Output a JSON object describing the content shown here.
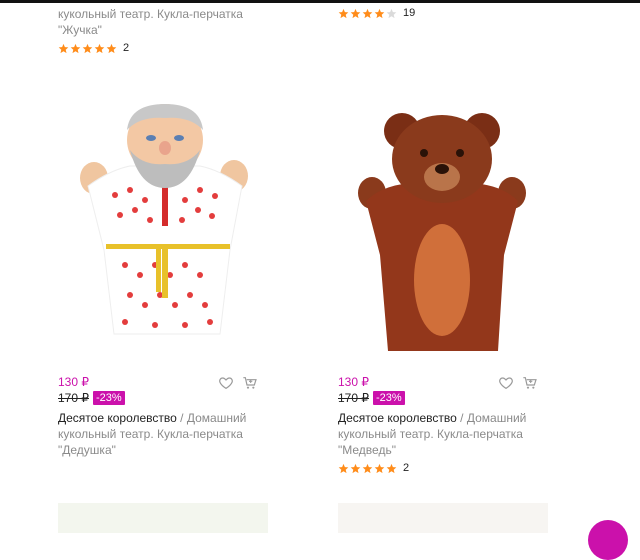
{
  "top_cards": {
    "left": {
      "line1": "кукольный театр. Кукла-перчатка",
      "line2": "\"Жучка\"",
      "rating": 5,
      "reviews": "2"
    },
    "right": {
      "rating": 4,
      "reviews": "19"
    }
  },
  "products": [
    {
      "price": "130 ₽",
      "old_price": "170 ₽",
      "discount": "-23%",
      "brand": "Десятое королевство",
      "separator": " / ",
      "title_1": "Домашний",
      "title_2": "кукольный театр. Кукла-перчатка",
      "title_3": "\"Дедушка\"",
      "rating": 0,
      "reviews": ""
    },
    {
      "price": "130 ₽",
      "old_price": "170 ₽",
      "discount": "-23%",
      "brand": "Десятое королевство",
      "separator": " / ",
      "title_1": "Домашний",
      "title_2": "кукольный театр. Кукла-перчатка",
      "title_3": "\"Медведь\"",
      "rating": 5,
      "reviews": "2"
    }
  ],
  "icons": {
    "wishlist": "heart-icon",
    "cart": "cart-icon",
    "star": "star-icon"
  },
  "colors": {
    "accent": "#cb11ab",
    "star_filled": "#ff8c1a",
    "star_empty": "#dadada"
  }
}
